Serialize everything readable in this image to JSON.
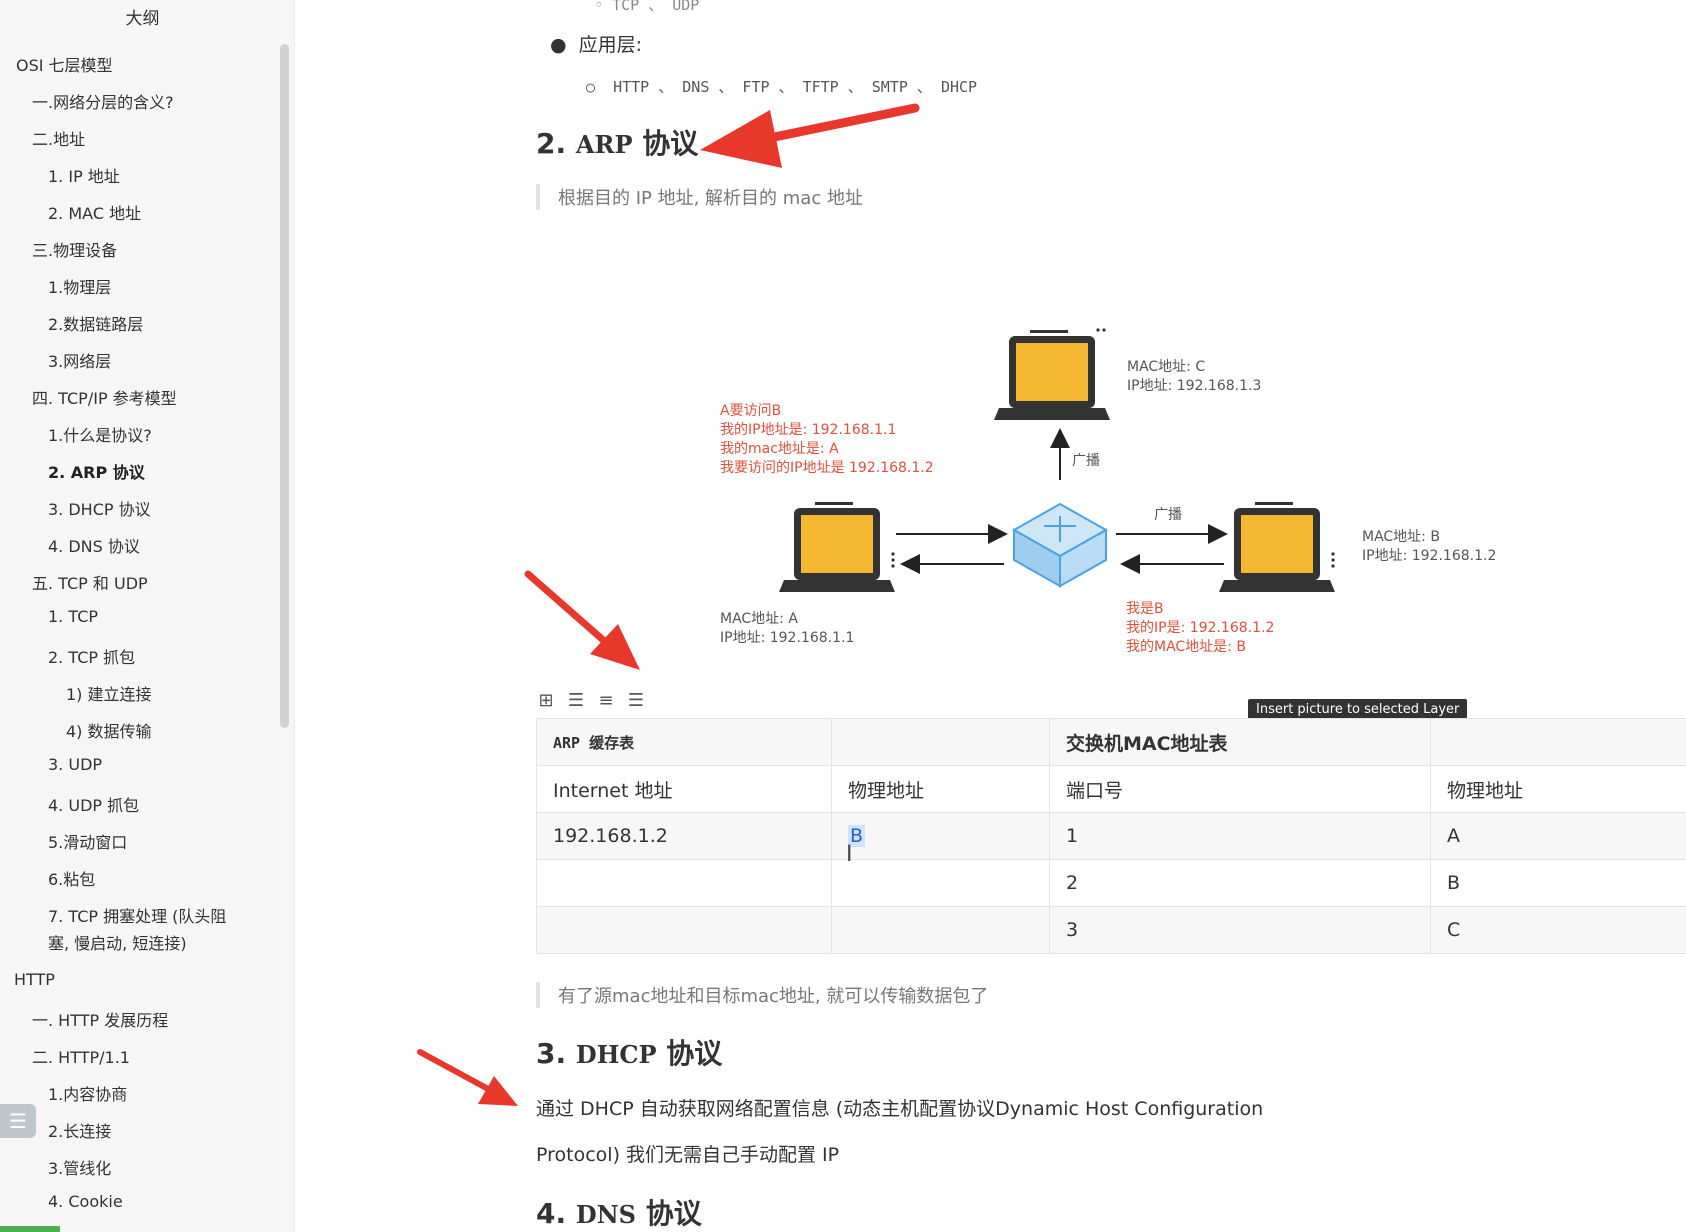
{
  "sidebar": {
    "title": "大纲",
    "items": [
      "OSI 七层模型",
      "一.网络分层的含义?",
      "二.地址",
      "1. IP 地址",
      "2. MAC 地址",
      "三.物理设备",
      "1.物理层",
      "2.数据链路层",
      "3.网络层",
      "四. TCP/IP 参考模型",
      "1.什么是协议?",
      "2. ARP 协议",
      "3. DHCP 协议",
      "4. DNS 协议",
      "五. TCP 和 UDP",
      "1. TCP",
      "2. TCP 抓包",
      "1) 建立连接",
      "4) 数据传输",
      "3. UDP",
      "4. UDP 抓包",
      "5.滑动窗口",
      "6.粘包",
      "7. TCP 拥塞处理 (队头阻",
      "塞, 慢启动, 短连接)",
      "HTTP",
      "一. HTTP 发展历程",
      "二. HTTP/1.1",
      "1.内容协商",
      "2.长连接",
      "3.管线化",
      "4. Cookie"
    ],
    "toggle_icon": "outline-toggle-icon"
  },
  "content": {
    "top_partial": "TCP 、 UDP",
    "app_layer_label": "应用层:",
    "app_protocols": "HTTP 、 DNS 、 FTP 、 TFTP 、 SMTP 、 DHCP",
    "arp_heading_num": "2.",
    "arp_heading_code": "ARP",
    "arp_heading_text": "协议",
    "arp_quote": "根据目的 IP 地址, 解析目的 mac 地址",
    "diagram": {
      "a_request_lines": [
        "A要访问B",
        "我的IP地址是: 192.168.1.1",
        "我的mac地址是: A",
        "我要访问的IP地址是 192.168.1.2"
      ],
      "pc_c_label": [
        "MAC地址: C",
        "IP地址: 192.168.1.3"
      ],
      "pc_b_label": [
        "MAC地址: B",
        "IP地址: 192.168.1.2"
      ],
      "pc_a_label": [
        "MAC地址: A",
        "IP地址: 192.168.1.1"
      ],
      "b_reply_lines": [
        "我是B",
        "我的IP是: 192.168.1.2",
        "我的MAC地址是: B"
      ],
      "broadcast_up": "广播",
      "broadcast_right": "广播"
    },
    "tooltip": "Insert picture to selected Layer",
    "table": {
      "header": [
        "ARP 缓存表",
        "",
        "交换机MAC地址表",
        ""
      ],
      "subheader": [
        "Internet 地址",
        "物理地址",
        "端口号",
        "物理地址"
      ],
      "rows": [
        [
          "192.168.1.2",
          "B",
          "1",
          "A"
        ],
        [
          "",
          "",
          "2",
          "B"
        ],
        [
          "",
          "",
          "3",
          "C"
        ]
      ]
    },
    "after_table_quote": "有了源mac地址和目标mac地址, 就可以传输数据包了",
    "dhcp_heading_num": "3.",
    "dhcp_heading_code": "DHCP",
    "dhcp_heading_text": "协议",
    "dhcp_para_line1": "通过 DHCP 自动获取网络配置信息 (动态主机配置协议Dynamic Host Configuration",
    "dhcp_para_line2": "Protocol) 我们无需自己手动配置 IP",
    "dns_heading_num": "4.",
    "dns_heading_code": "DNS",
    "dns_heading_text": "协议"
  },
  "colors": {
    "annotation_arrow": "#e8382c",
    "laptop_screen": "#f5b731",
    "diagram_red_text": "#e0503c",
    "switch_blue": "#4aa3e8"
  }
}
